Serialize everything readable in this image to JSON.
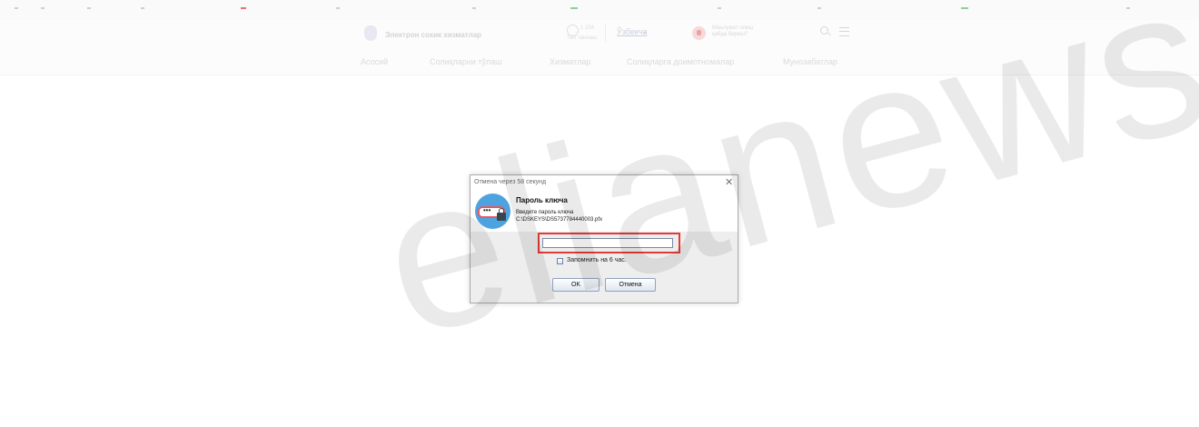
{
  "site": {
    "title": "Электрон сохик хизматлар",
    "stat_count": "1 234",
    "stat_label": "Тил танлаш",
    "language": "Ўзбекча",
    "help_line1": "Маълумот олиш",
    "help_line2": "қайда бериш?"
  },
  "nav": [
    "Асосий",
    "Солиқларни тўлаш",
    "Хизматлар",
    "Солиқларга доимотномалар",
    "Мунозабатлар"
  ],
  "dialog": {
    "title": "Отмена через 58 секунд",
    "close_symbol": "✕",
    "heading": "Пароль ключа",
    "prompt": "Введите пароль ключа",
    "key_path": "C:\\DSKEYS\\DS5737784440003.pfx",
    "password_value": "",
    "remember_label": "Запомнить на 6 час.",
    "remember_checked": false,
    "ok_label": "OK",
    "cancel_label": "Отмена"
  },
  "watermark": "elianews",
  "colors": {
    "highlight": "#e53935",
    "key_icon_bg": "#4da3df",
    "dialog_bg": "#eeeeee"
  }
}
